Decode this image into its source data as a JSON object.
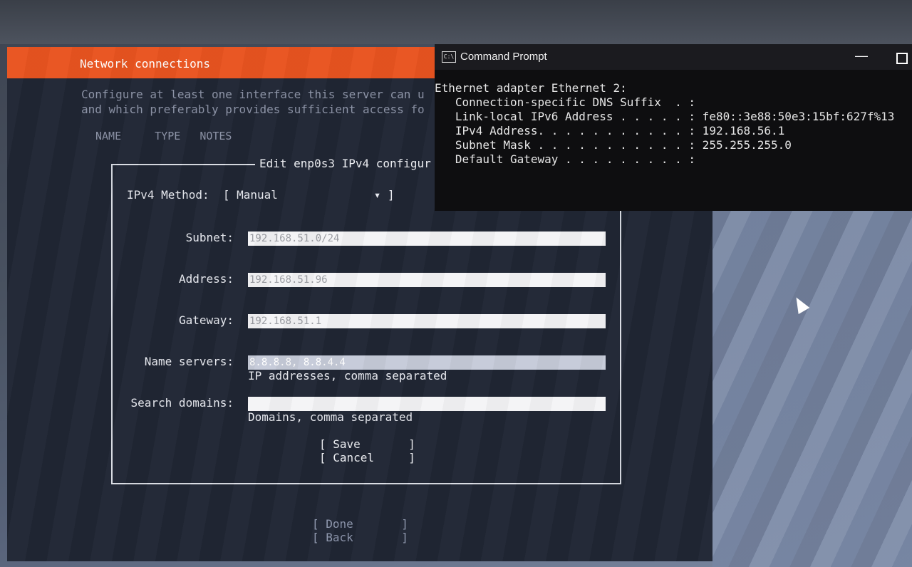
{
  "installer": {
    "header_title": "Network connections",
    "intro_line1": "Configure at least one interface this server can u",
    "intro_line2": "and which preferably provides sufficient access fo",
    "columns": [
      "NAME",
      "TYPE",
      "NOTES"
    ],
    "done_label": "[ Done       ]",
    "back_label": "[ Back       ]"
  },
  "dialog": {
    "title": "Edit enp0s3 IPv4 configur",
    "method_label": "IPv4 Method:",
    "method_value": "[ Manual              ▾ ]",
    "subnet_label": "Subnet:",
    "subnet_value": "192.168.51.0/24",
    "address_label": "Address:",
    "address_value": "192.168.51.96",
    "gateway_label": "Gateway:",
    "gateway_value": "192.168.51.1",
    "nameservers_label": "Name servers:",
    "nameservers_value": "8.8.8.8, 8.8.4.4",
    "nameservers_hint": "IP addresses, comma separated",
    "searchdomains_label": "Search domains:",
    "searchdomains_value": "",
    "searchdomains_hint": "Domains, comma separated",
    "save_label": "[ Save       ]",
    "cancel_label": "[ Cancel     ]"
  },
  "cmd": {
    "window_title": "Command Prompt",
    "icon_text": "C:\\",
    "lines": [
      "Ethernet adapter Ethernet 2:",
      "",
      "   Connection-specific DNS Suffix  . :",
      "   Link-local IPv6 Address . . . . . : fe80::3e88:50e3:15bf:627f%13",
      "   IPv4 Address. . . . . . . . . . . : 192.168.56.1",
      "   Subnet Mask . . . . . . . . . . . : 255.255.255.0",
      "   Default Gateway . . . . . . . . . :"
    ]
  },
  "colors": {
    "accent": "#e95420",
    "screen_bg": "#202634"
  },
  "icons": [
    "cmd-icon",
    "minimize-icon",
    "maximize-icon",
    "mouse-cursor-icon",
    "dropdown-arrow-icon"
  ]
}
